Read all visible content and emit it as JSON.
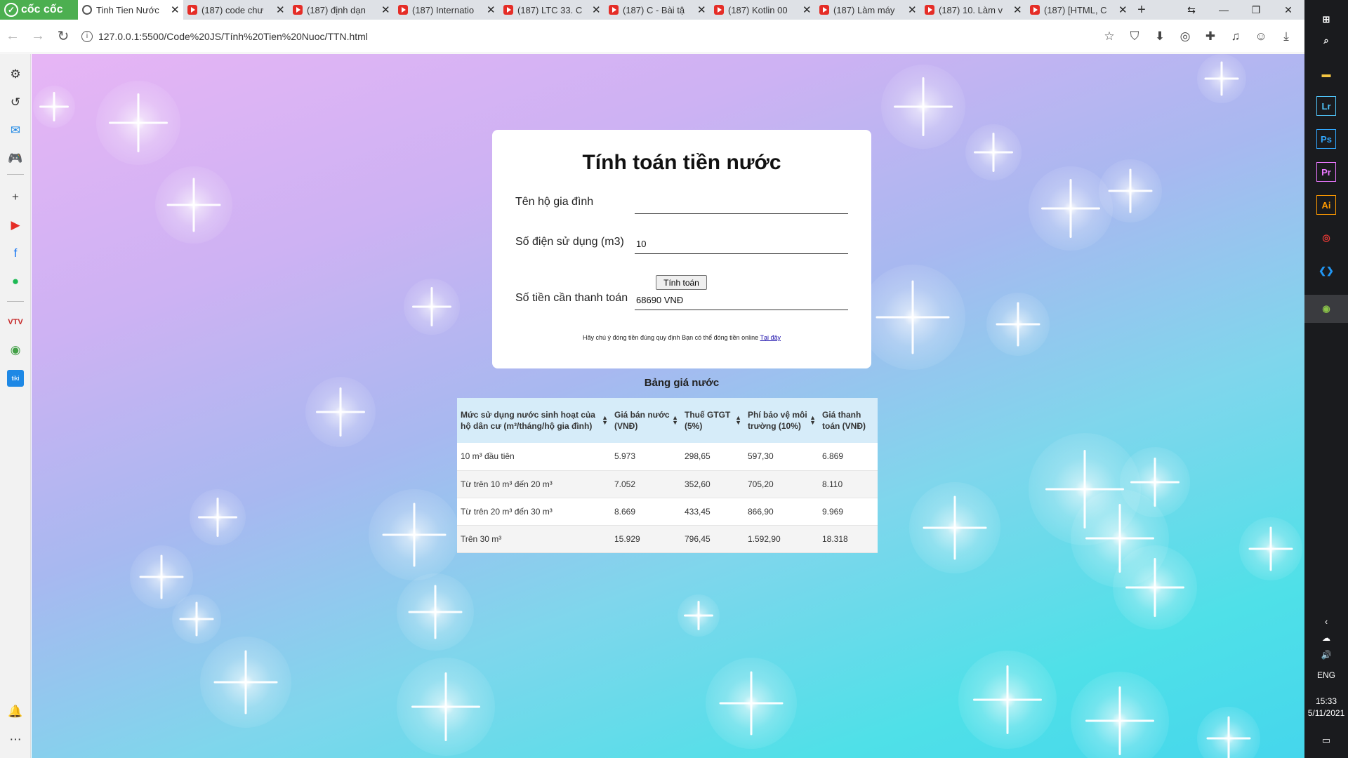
{
  "browser": {
    "brand": "cốc cốc",
    "tabs": [
      {
        "title": "Tinh Tien Nước",
        "active": true,
        "icon": "globe-icon"
      },
      {
        "title": "(187) code chư",
        "icon": "youtube-icon"
      },
      {
        "title": "(187) định dạn",
        "icon": "youtube-icon"
      },
      {
        "title": "(187) Internatio",
        "icon": "youtube-icon"
      },
      {
        "title": "(187) LTC 33. C",
        "icon": "youtube-icon"
      },
      {
        "title": "(187) C - Bài tậ",
        "icon": "youtube-icon"
      },
      {
        "title": "(187) Kotlin 00",
        "icon": "youtube-icon"
      },
      {
        "title": "(187) Làm máy",
        "icon": "youtube-icon"
      },
      {
        "title": "(187) 10. Làm v",
        "icon": "youtube-icon"
      },
      {
        "title": "(187) [HTML, C",
        "icon": "youtube-icon"
      }
    ],
    "url": "127.0.0.1:5500/Code%20JS/Tính%20Tien%20Nuoc/TTN.html"
  },
  "taskbar": {
    "lang": "ENG",
    "time": "15:33",
    "date": "5/11/2021"
  },
  "form": {
    "title": "Tính toán tiền nước",
    "household_label": "Tên hộ gia đình",
    "household_value": "",
    "usage_label": "Số điện sử dụng (m3)",
    "usage_value": "10",
    "calc_button": "Tính toán",
    "payment_label": "Số tiền cần thanh toán",
    "payment_value": "68690 VNĐ",
    "note": "Hãy chú ý đóng tiền đúng quy định Bạn có thể đóng tiền online ",
    "note_link": "Tại đây"
  },
  "price_table": {
    "title": "Bảng giá nước",
    "headers": [
      "Mức sử dụng nước sinh hoạt của hộ dân cư (m³/tháng/hộ gia đình)",
      "Giá bán nước (VNĐ)",
      "Thuế GTGT (5%)",
      "Phí bảo vệ môi trường (10%)",
      "Giá thanh toán (VNĐ)"
    ],
    "rows": [
      [
        "10 m³ đầu tiên",
        "5.973",
        "298,65",
        "597,30",
        "6.869"
      ],
      [
        "Từ trên 10 m³ đến 20 m³",
        "7.052",
        "352,60",
        "705,20",
        "8.110"
      ],
      [
        "Từ trên 20 m³ đến 30 m³",
        "8.669",
        "433,45",
        "866,90",
        "9.969"
      ],
      [
        "Trên 30 m³",
        "15.929",
        "796,45",
        "1.592,90",
        "18.318"
      ]
    ]
  }
}
